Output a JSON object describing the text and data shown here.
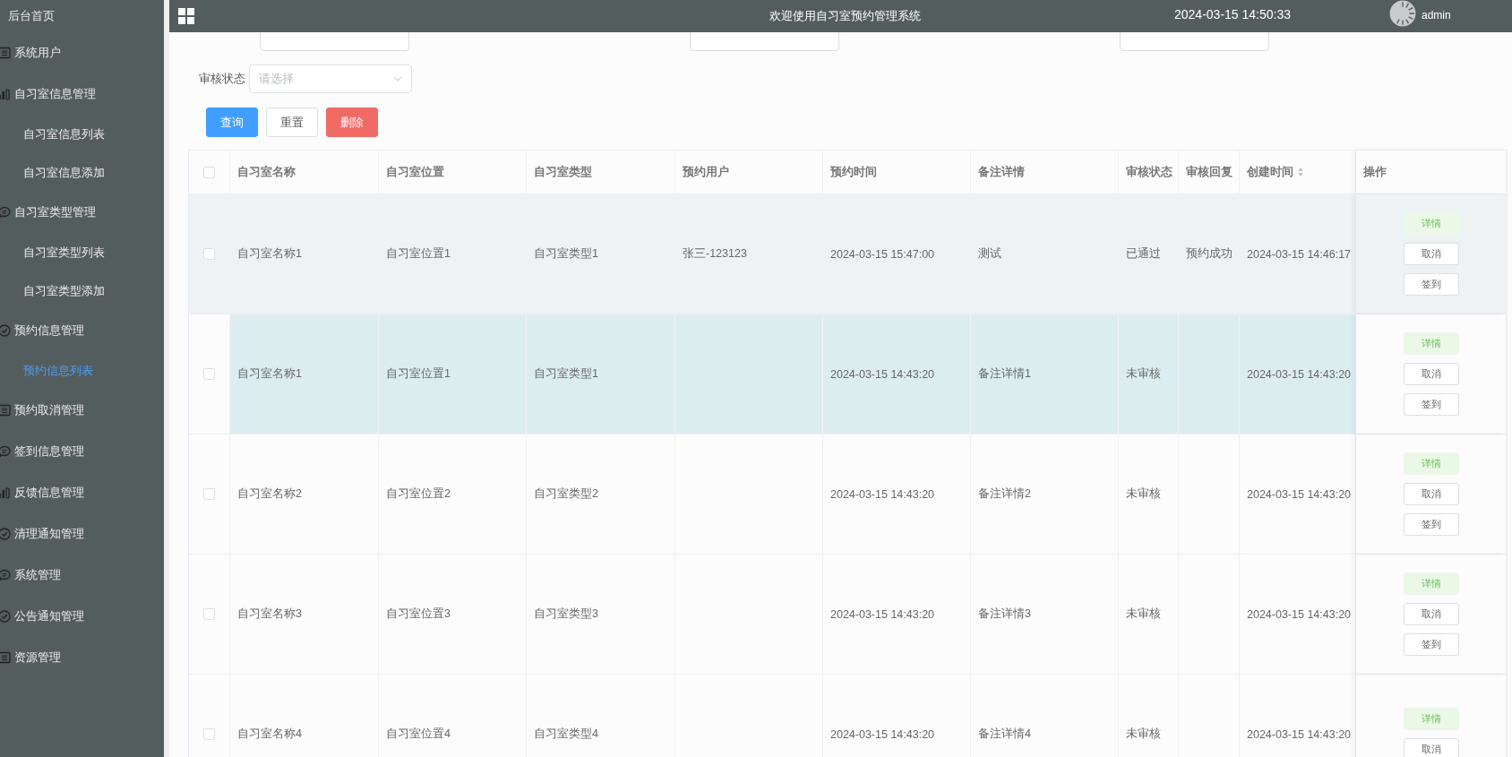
{
  "sidebar": {
    "home": "后台首页",
    "items": [
      {
        "label": "系统用户"
      },
      {
        "label": "自习室信息管理",
        "children": [
          {
            "label": "自习室信息列表",
            "selected": false
          },
          {
            "label": "自习室信息添加",
            "selected": false
          }
        ]
      },
      {
        "label": "自习室类型管理",
        "children": [
          {
            "label": "自习室类型列表",
            "selected": false
          },
          {
            "label": "自习室类型添加",
            "selected": false
          }
        ]
      },
      {
        "label": "预约信息管理",
        "children": [
          {
            "label": "预约信息列表",
            "selected": true
          }
        ]
      },
      {
        "label": "预约取消管理"
      },
      {
        "label": "签到信息管理"
      },
      {
        "label": "反馈信息管理"
      },
      {
        "label": "清理通知管理"
      },
      {
        "label": "系统管理"
      },
      {
        "label": "公告通知管理"
      },
      {
        "label": "资源管理"
      }
    ]
  },
  "header": {
    "title": "欢迎使用自习室预约管理系统",
    "datetime": "2024-03-15 14:50:33",
    "user": "admin"
  },
  "filters": [
    {
      "kind": "input"
    },
    {
      "kind": "input"
    },
    {
      "kind": "input"
    },
    {
      "label": "审核状态",
      "kind": "select",
      "placeholder": "请选择"
    }
  ],
  "buttons": [
    {
      "label": "查询",
      "kind": "primary"
    },
    {
      "label": "重置",
      "kind": "plain"
    },
    {
      "label": "删除",
      "kind": "danger"
    }
  ],
  "table": {
    "select_all": {
      "checked": false
    },
    "columns": [
      {
        "label": "自习室名称",
        "sortable": false
      },
      {
        "label": "自习室位置",
        "sortable": false
      },
      {
        "label": "自习室类型",
        "sortable": false
      },
      {
        "label": "预约用户",
        "sortable": false
      },
      {
        "label": "预约时间",
        "sortable": false
      },
      {
        "label": "备注详情",
        "sortable": false
      },
      {
        "label": "审核状态",
        "sortable": false
      },
      {
        "label": "审核回复",
        "sortable": false
      },
      {
        "label": "创建时间",
        "sortable": true
      }
    ],
    "actions_column": "操作",
    "rows": [
      {
        "checked": false,
        "hovered": true,
        "selected": false,
        "cells": [
          "自习室名称1",
          "自习室位置1",
          "自习室类型1",
          "张三-123123",
          "2024-03-15 15:47:00",
          "测试",
          "已通过",
          "预约成功",
          "2024-03-15 14:46:17"
        ],
        "actions": [
          {
            "label": "详情",
            "kind": "success"
          },
          {
            "label": "取消",
            "kind": "plain"
          },
          {
            "label": "签到",
            "kind": "plain"
          }
        ]
      },
      {
        "checked": false,
        "hovered": false,
        "selected": true,
        "cells": [
          "自习室名称1",
          "自习室位置1",
          "自习室类型1",
          null,
          "2024-03-15 14:43:20",
          "备注详情1",
          "未审核",
          null,
          "2024-03-15 14:43:20"
        ],
        "actions": [
          {
            "label": "详情",
            "kind": "success"
          },
          {
            "label": "取消",
            "kind": "plain"
          },
          {
            "label": "签到",
            "kind": "plain"
          }
        ]
      },
      {
        "checked": false,
        "hovered": false,
        "selected": false,
        "cells": [
          "自习室名称2",
          "自习室位置2",
          "自习室类型2",
          null,
          "2024-03-15 14:43:20",
          "备注详情2",
          "未审核",
          null,
          "2024-03-15 14:43:20"
        ],
        "actions": [
          {
            "label": "详情",
            "kind": "success"
          },
          {
            "label": "取消",
            "kind": "plain"
          },
          {
            "label": "签到",
            "kind": "plain"
          }
        ]
      },
      {
        "checked": false,
        "hovered": false,
        "selected": false,
        "cells": [
          "自习室名称3",
          "自习室位置3",
          "自习室类型3",
          null,
          "2024-03-15 14:43:20",
          "备注详情3",
          "未审核",
          null,
          "2024-03-15 14:43:20"
        ],
        "actions": [
          {
            "label": "详情",
            "kind": "success"
          },
          {
            "label": "取消",
            "kind": "plain"
          },
          {
            "label": "签到",
            "kind": "plain"
          }
        ]
      },
      {
        "checked": false,
        "hovered": false,
        "selected": false,
        "cells": [
          "自习室名称4",
          "自习室位置4",
          "自习室类型4",
          null,
          "2024-03-15 14:43:20",
          "备注详情4",
          "未审核",
          null,
          "2024-03-15 14:43:20"
        ],
        "actions": [
          {
            "label": "详情",
            "kind": "success"
          },
          {
            "label": "取消",
            "kind": "plain"
          }
        ]
      }
    ]
  }
}
